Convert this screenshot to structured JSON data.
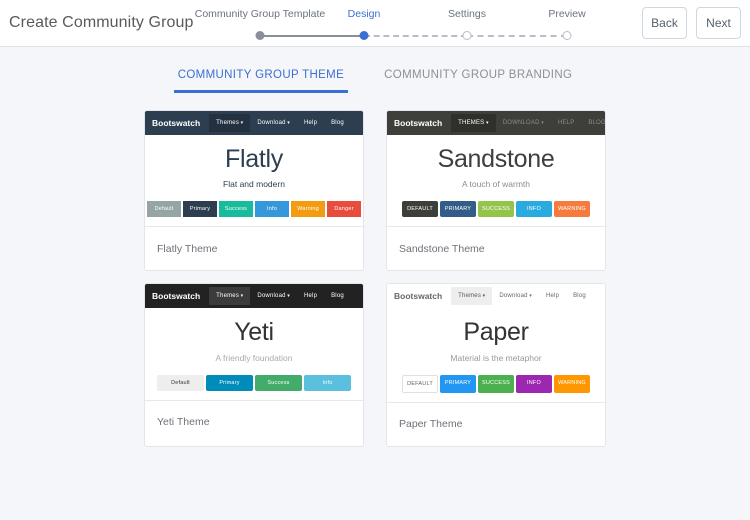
{
  "header": {
    "title": "Create Community Group",
    "back_label": "Back",
    "next_label": "Next"
  },
  "wizard": {
    "steps": [
      {
        "label": "Community Group Template",
        "state": "done"
      },
      {
        "label": "Design",
        "state": "active"
      },
      {
        "label": "Settings",
        "state": "todo"
      },
      {
        "label": "Preview",
        "state": "todo"
      }
    ],
    "active_color": "#3b6fd4",
    "done_color": "#8a8f98",
    "todo_color": "#b9bdc4"
  },
  "tabs": [
    {
      "label": "COMMUNITY GROUP THEME",
      "active": true
    },
    {
      "label": "COMMUNITY GROUP BRANDING",
      "active": false
    }
  ],
  "themes": [
    {
      "name": "Flatly",
      "footer": "Flatly Theme",
      "tagline": "Flat and modern",
      "brand": "Bootswatch",
      "nav_bg": "#2c3e50",
      "nav_active_bg": "#233140",
      "nav_brand_color": "#ffffff",
      "nav_link_color": "#ffffff",
      "title_color": "#2c3e50",
      "tagline_color": "#2c3e50",
      "body_bg": "#ffffff",
      "links": [
        {
          "label": "Themes",
          "caret": true,
          "active": true
        },
        {
          "label": "Download",
          "caret": true,
          "active": false
        },
        {
          "label": "Help",
          "caret": false,
          "active": false
        },
        {
          "label": "Blog",
          "caret": false,
          "active": false
        }
      ],
      "buttons": [
        {
          "label": "Default",
          "bg": "#95a5a6",
          "fg": "#ffffff"
        },
        {
          "label": "Primary",
          "bg": "#2c3e50",
          "fg": "#ffffff"
        },
        {
          "label": "Success",
          "bg": "#18bc9c",
          "fg": "#ffffff"
        },
        {
          "label": "Info",
          "bg": "#3498db",
          "fg": "#ffffff"
        },
        {
          "label": "Warning",
          "bg": "#f39c12",
          "fg": "#ffffff"
        },
        {
          "label": "Danger",
          "bg": "#e74c3c",
          "fg": "#ffffff"
        }
      ]
    },
    {
      "name": "Sandstone",
      "footer": "Sandstone Theme",
      "tagline": "A touch of warmth",
      "brand": "Bootswatch",
      "nav_bg": "#3e3f3a",
      "nav_active_bg": "#2f302c",
      "nav_brand_color": "#ffffff",
      "nav_link_color": "#8e8c84",
      "title_color": "#3e3f3a",
      "tagline_color": "#8e8c84",
      "body_bg": "#ffffff",
      "links": [
        {
          "label": "THEMES",
          "caret": true,
          "active": true
        },
        {
          "label": "DOWNLOAD",
          "caret": true,
          "active": false
        },
        {
          "label": "HELP",
          "caret": false,
          "active": false
        },
        {
          "label": "BLOG",
          "caret": false,
          "active": false
        }
      ],
      "buttons": [
        {
          "label": "DEFAULT",
          "bg": "#3e3f3a",
          "fg": "#ffffff"
        },
        {
          "label": "PRIMARY",
          "bg": "#325d88",
          "fg": "#ffffff"
        },
        {
          "label": "SUCCESS",
          "bg": "#93c54b",
          "fg": "#ffffff"
        },
        {
          "label": "INFO",
          "bg": "#29abe0",
          "fg": "#ffffff"
        },
        {
          "label": "WARNING",
          "bg": "#f47c3c",
          "fg": "#ffffff"
        }
      ]
    },
    {
      "name": "Yeti",
      "footer": "Yeti Theme",
      "tagline": "A friendly foundation",
      "brand": "Bootswatch",
      "nav_bg": "#222222",
      "nav_active_bg": "#3b3b3b",
      "nav_brand_color": "#ffffff",
      "nav_link_color": "#ffffff",
      "title_color": "#333333",
      "tagline_color": "#aaaaaa",
      "body_bg": "#ffffff",
      "links": [
        {
          "label": "Themes",
          "caret": true,
          "active": true
        },
        {
          "label": "Download",
          "caret": true,
          "active": false
        },
        {
          "label": "Help",
          "caret": false,
          "active": false
        },
        {
          "label": "Blog",
          "caret": false,
          "active": false
        }
      ],
      "buttons": [
        {
          "label": "Default",
          "bg": "#eeeeee",
          "fg": "#333333"
        },
        {
          "label": "Primary",
          "bg": "#008cba",
          "fg": "#ffffff"
        },
        {
          "label": "Success",
          "bg": "#43ac6a",
          "fg": "#ffffff"
        },
        {
          "label": "Info",
          "bg": "#5bc0de",
          "fg": "#ffffff"
        }
      ]
    },
    {
      "name": "Paper",
      "footer": "Paper Theme",
      "tagline": "Material is the metaphor",
      "brand": "Bootswatch",
      "nav_bg": "#ffffff",
      "nav_active_bg": "#eeeeee",
      "nav_brand_color": "#666666",
      "nav_link_color": "#666666",
      "title_color": "#333333",
      "tagline_color": "#999999",
      "body_bg": "#ffffff",
      "links": [
        {
          "label": "Themes",
          "caret": true,
          "active": true
        },
        {
          "label": "Download",
          "caret": true,
          "active": false
        },
        {
          "label": "Help",
          "caret": false,
          "active": false
        },
        {
          "label": "Blog",
          "caret": false,
          "active": false
        }
      ],
      "buttons": [
        {
          "label": "DEFAULT",
          "bg": "#ffffff",
          "fg": "#666666"
        },
        {
          "label": "PRIMARY",
          "bg": "#2196f3",
          "fg": "#ffffff"
        },
        {
          "label": "SUCCESS",
          "bg": "#4caf50",
          "fg": "#ffffff"
        },
        {
          "label": "INFO",
          "bg": "#9c27b0",
          "fg": "#ffffff"
        },
        {
          "label": "WARNING",
          "bg": "#ff9800",
          "fg": "#ffffff"
        }
      ]
    }
  ]
}
